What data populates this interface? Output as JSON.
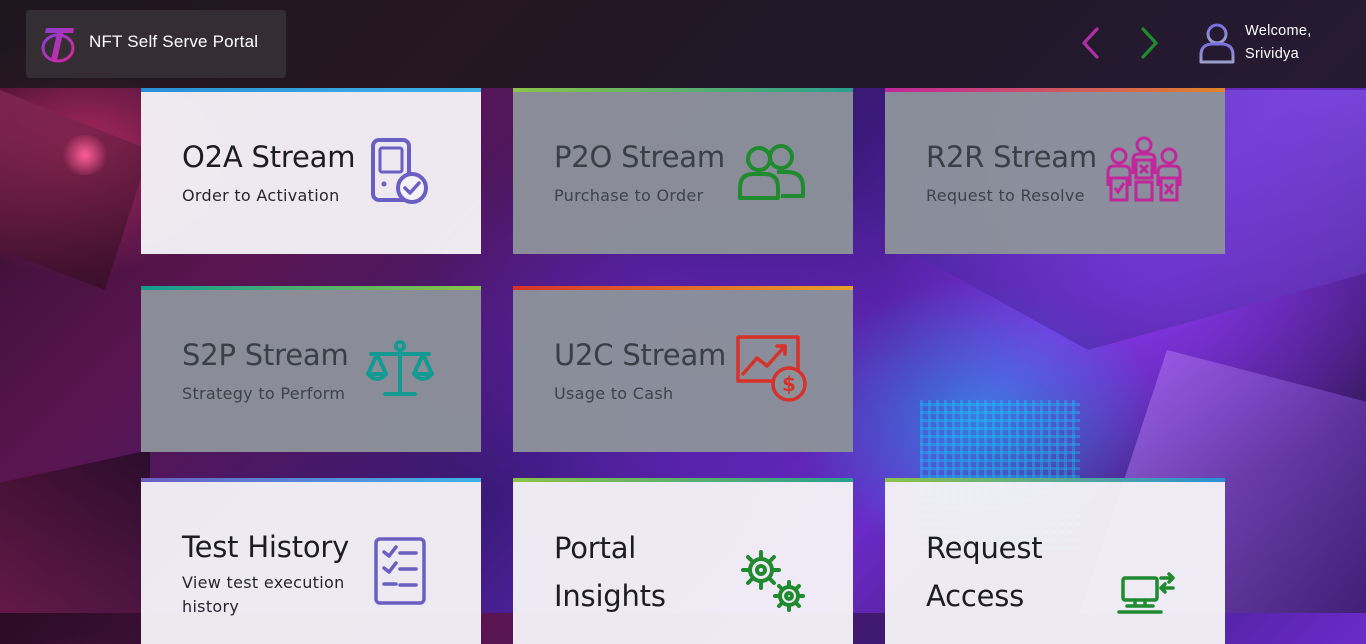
{
  "header": {
    "app_title": "NFT Self Serve Portal",
    "welcome_line1": "Welcome,",
    "welcome_line2": "Srividya"
  },
  "icons": {
    "logo": "telstra-logo-icon",
    "prev": "chevron-left-icon",
    "next": "chevron-right-icon",
    "user": "user-icon"
  },
  "colors": {
    "prev_arrow": "#b02fa8",
    "next_arrow": "#1f8a2e",
    "avatar": "#8a7fd6"
  },
  "cards": [
    {
      "title": "O2A Stream",
      "subtitle": "Order to Activation",
      "icon": "device-check-icon",
      "accent": "#6a5fc2"
    },
    {
      "title": "P2O Stream",
      "subtitle": "Purchase to Order",
      "icon": "group-users-icon",
      "accent": "#1f8a2e"
    },
    {
      "title": "R2R Stream",
      "subtitle": "Request to Resolve",
      "icon": "team-review-icon",
      "accent": "#c0279b"
    },
    {
      "title": "S2P Stream",
      "subtitle": "Strategy to Perform",
      "icon": "balance-scale-icon",
      "accent": "#149a92"
    },
    {
      "title": "U2C Stream",
      "subtitle": "Usage to Cash",
      "icon": "chart-dollar-icon",
      "accent": "#d6322a"
    },
    {
      "title": "Test History",
      "subtitle": "View test execution history",
      "icon": "checklist-icon",
      "accent": "#6a5fc2"
    },
    {
      "title": "Portal Insights",
      "subtitle": "",
      "icon": "gears-icon",
      "accent": "#1f8a2e"
    },
    {
      "title": "Request Access",
      "subtitle": "",
      "icon": "computer-access-icon",
      "accent": "#1f8a2e"
    }
  ]
}
